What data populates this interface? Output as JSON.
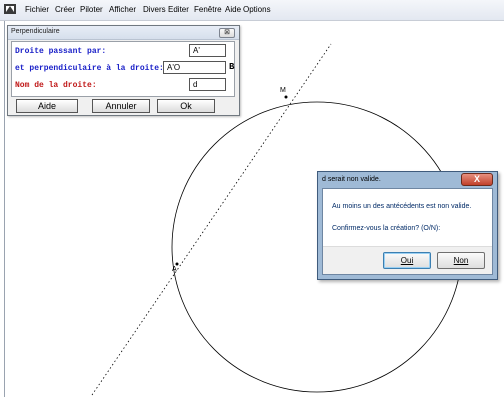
{
  "menubar": {
    "items": [
      "Fichier",
      "Créer",
      "Piloter",
      "Afficher",
      "Divers",
      "Editer",
      "Fenêtre",
      "Aide",
      "Options"
    ]
  },
  "perp_dialog": {
    "title": "Perpendiculaire",
    "close_label": "⊠",
    "label1": "Droite passant par:",
    "value1": "A'",
    "label2": "et perpendiculaire à la droite:",
    "value2": "A'O",
    "side_button": "B",
    "label3": "Nom de la droite:",
    "value3": "d",
    "btn_help": "Aide",
    "btn_cancel": "Annuler",
    "btn_ok": "Ok"
  },
  "error_dialog": {
    "title": "d serait non valide.",
    "close_label": "X",
    "message1": "Au moins un des antécédents est non valide.",
    "message2": "Confirmez-vous la création? (O/N):",
    "btn_yes": "Oui",
    "btn_no": "Non"
  },
  "figure": {
    "point_m_label": "M",
    "point_a_label": "A"
  },
  "colors": {
    "blue_label": "#1a20c8",
    "red_label": "#c01818",
    "close_red": "#c1402a"
  }
}
